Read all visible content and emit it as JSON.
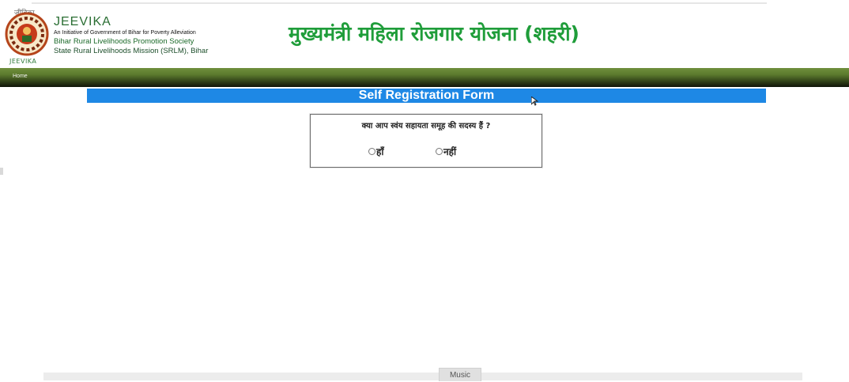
{
  "header": {
    "logo_small_text": "जीविका",
    "logo_caption": "JEEVIKA",
    "org_name": "JEEVIKA",
    "org_tagline": "An Initiative of Government of Bihar for Poverty Alleviation",
    "org_society": "Bihar Rural Livelihoods Promotion Society",
    "org_mission": "State Rural Livelihoods Mission (SRLM), Bihar",
    "scheme_title": "मुख्यमंत्री महिला रोजगार योजना (शहरी)"
  },
  "nav": {
    "home_label": "Home"
  },
  "form": {
    "title": "Self Registration Form",
    "question": "क्या आप स्वंय सहायता समूह की सदस्य हैं ?",
    "options": [
      {
        "label": "हाँ",
        "selected": false
      },
      {
        "label": "नहीं",
        "selected": false
      }
    ]
  },
  "footer": {
    "music_tab": "Music"
  },
  "colors": {
    "form_header_bg": "#1e88e5",
    "scheme_title": "#1f9d3a",
    "navbar_dark": "#101509",
    "navbar_light": "#6f8f3d"
  },
  "icons": {
    "logo": "jeevika-emblem-icon",
    "cursor": "mouse-cursor-icon"
  }
}
